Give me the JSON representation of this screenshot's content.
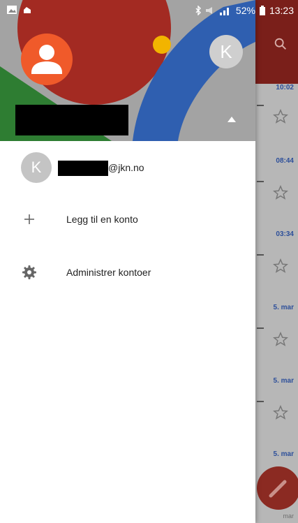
{
  "status_bar": {
    "battery": "52%",
    "time": "13:23"
  },
  "drawer": {
    "account_avatar_letter": "K",
    "account_email_suffix": "@jkn.no",
    "menu": [
      {
        "label": "Legg til en konto",
        "icon": "plus-icon"
      },
      {
        "label": "Administrer kontoer",
        "icon": "gear-icon"
      }
    ]
  },
  "background_inbox": {
    "times": [
      "10:02",
      "08:44",
      "03:34",
      "5. mar",
      "5. mar",
      "5. mar"
    ],
    "bottom_label": "mar"
  },
  "colors": {
    "avatar_orange": "#f05a2a",
    "toolbar_red": "#7a1f1a",
    "header_blue": "#2f5fb0",
    "header_green": "#2e7d32",
    "header_red": "#a32a22",
    "header_yellow": "#f2b400"
  }
}
